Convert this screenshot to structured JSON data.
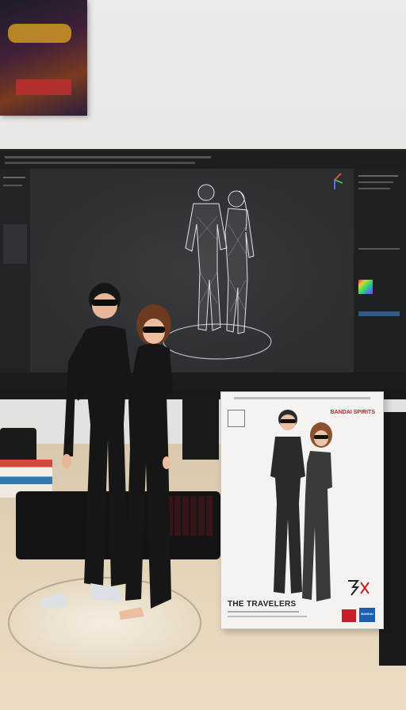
{
  "scene": {
    "description_tags": [
      "photo",
      "desk",
      "monitor",
      "figure",
      "box"
    ]
  },
  "box": {
    "title": "THE TRAVELERS",
    "brand_top": "BANDAI SPIRITS",
    "brand_bottom": "BANDAI"
  },
  "colors": {
    "wall": "#e9e7e3",
    "desk": "#e0cfb2",
    "outfit": "#161616",
    "screen": "#2c2d30",
    "wireframe": "#dfe3ea",
    "bandai_blue": "#1a5fb0",
    "accent_red": "#c8202a"
  }
}
